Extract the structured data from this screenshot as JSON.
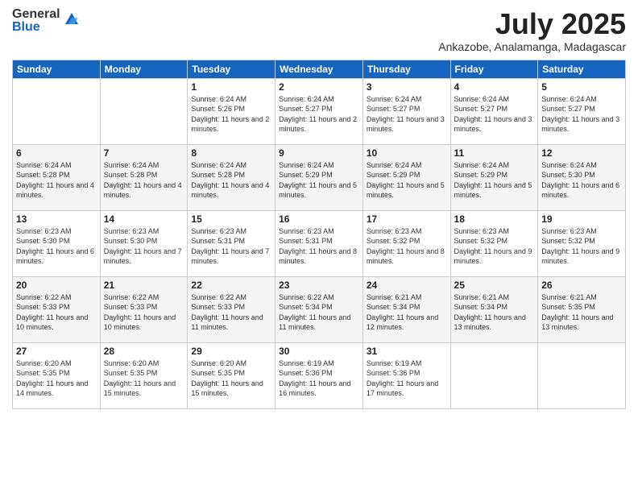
{
  "logo": {
    "general": "General",
    "blue": "Blue"
  },
  "title": "July 2025",
  "location": "Ankazobe, Analamanga, Madagascar",
  "headers": [
    "Sunday",
    "Monday",
    "Tuesday",
    "Wednesday",
    "Thursday",
    "Friday",
    "Saturday"
  ],
  "weeks": [
    [
      {
        "day": "",
        "sunrise": "",
        "sunset": "",
        "daylight": ""
      },
      {
        "day": "",
        "sunrise": "",
        "sunset": "",
        "daylight": ""
      },
      {
        "day": "1",
        "sunrise": "Sunrise: 6:24 AM",
        "sunset": "Sunset: 5:26 PM",
        "daylight": "Daylight: 11 hours and 2 minutes."
      },
      {
        "day": "2",
        "sunrise": "Sunrise: 6:24 AM",
        "sunset": "Sunset: 5:27 PM",
        "daylight": "Daylight: 11 hours and 2 minutes."
      },
      {
        "day": "3",
        "sunrise": "Sunrise: 6:24 AM",
        "sunset": "Sunset: 5:27 PM",
        "daylight": "Daylight: 11 hours and 3 minutes."
      },
      {
        "day": "4",
        "sunrise": "Sunrise: 6:24 AM",
        "sunset": "Sunset: 5:27 PM",
        "daylight": "Daylight: 11 hours and 3 minutes."
      },
      {
        "day": "5",
        "sunrise": "Sunrise: 6:24 AM",
        "sunset": "Sunset: 5:27 PM",
        "daylight": "Daylight: 11 hours and 3 minutes."
      }
    ],
    [
      {
        "day": "6",
        "sunrise": "Sunrise: 6:24 AM",
        "sunset": "Sunset: 5:28 PM",
        "daylight": "Daylight: 11 hours and 4 minutes."
      },
      {
        "day": "7",
        "sunrise": "Sunrise: 6:24 AM",
        "sunset": "Sunset: 5:28 PM",
        "daylight": "Daylight: 11 hours and 4 minutes."
      },
      {
        "day": "8",
        "sunrise": "Sunrise: 6:24 AM",
        "sunset": "Sunset: 5:28 PM",
        "daylight": "Daylight: 11 hours and 4 minutes."
      },
      {
        "day": "9",
        "sunrise": "Sunrise: 6:24 AM",
        "sunset": "Sunset: 5:29 PM",
        "daylight": "Daylight: 11 hours and 5 minutes."
      },
      {
        "day": "10",
        "sunrise": "Sunrise: 6:24 AM",
        "sunset": "Sunset: 5:29 PM",
        "daylight": "Daylight: 11 hours and 5 minutes."
      },
      {
        "day": "11",
        "sunrise": "Sunrise: 6:24 AM",
        "sunset": "Sunset: 5:29 PM",
        "daylight": "Daylight: 11 hours and 5 minutes."
      },
      {
        "day": "12",
        "sunrise": "Sunrise: 6:24 AM",
        "sunset": "Sunset: 5:30 PM",
        "daylight": "Daylight: 11 hours and 6 minutes."
      }
    ],
    [
      {
        "day": "13",
        "sunrise": "Sunrise: 6:23 AM",
        "sunset": "Sunset: 5:30 PM",
        "daylight": "Daylight: 11 hours and 6 minutes."
      },
      {
        "day": "14",
        "sunrise": "Sunrise: 6:23 AM",
        "sunset": "Sunset: 5:30 PM",
        "daylight": "Daylight: 11 hours and 7 minutes."
      },
      {
        "day": "15",
        "sunrise": "Sunrise: 6:23 AM",
        "sunset": "Sunset: 5:31 PM",
        "daylight": "Daylight: 11 hours and 7 minutes."
      },
      {
        "day": "16",
        "sunrise": "Sunrise: 6:23 AM",
        "sunset": "Sunset: 5:31 PM",
        "daylight": "Daylight: 11 hours and 8 minutes."
      },
      {
        "day": "17",
        "sunrise": "Sunrise: 6:23 AM",
        "sunset": "Sunset: 5:32 PM",
        "daylight": "Daylight: 11 hours and 8 minutes."
      },
      {
        "day": "18",
        "sunrise": "Sunrise: 6:23 AM",
        "sunset": "Sunset: 5:32 PM",
        "daylight": "Daylight: 11 hours and 9 minutes."
      },
      {
        "day": "19",
        "sunrise": "Sunrise: 6:23 AM",
        "sunset": "Sunset: 5:32 PM",
        "daylight": "Daylight: 11 hours and 9 minutes."
      }
    ],
    [
      {
        "day": "20",
        "sunrise": "Sunrise: 6:22 AM",
        "sunset": "Sunset: 5:33 PM",
        "daylight": "Daylight: 11 hours and 10 minutes."
      },
      {
        "day": "21",
        "sunrise": "Sunrise: 6:22 AM",
        "sunset": "Sunset: 5:33 PM",
        "daylight": "Daylight: 11 hours and 10 minutes."
      },
      {
        "day": "22",
        "sunrise": "Sunrise: 6:22 AM",
        "sunset": "Sunset: 5:33 PM",
        "daylight": "Daylight: 11 hours and 11 minutes."
      },
      {
        "day": "23",
        "sunrise": "Sunrise: 6:22 AM",
        "sunset": "Sunset: 5:34 PM",
        "daylight": "Daylight: 11 hours and 11 minutes."
      },
      {
        "day": "24",
        "sunrise": "Sunrise: 6:21 AM",
        "sunset": "Sunset: 5:34 PM",
        "daylight": "Daylight: 11 hours and 12 minutes."
      },
      {
        "day": "25",
        "sunrise": "Sunrise: 6:21 AM",
        "sunset": "Sunset: 5:34 PM",
        "daylight": "Daylight: 11 hours and 13 minutes."
      },
      {
        "day": "26",
        "sunrise": "Sunrise: 6:21 AM",
        "sunset": "Sunset: 5:35 PM",
        "daylight": "Daylight: 11 hours and 13 minutes."
      }
    ],
    [
      {
        "day": "27",
        "sunrise": "Sunrise: 6:20 AM",
        "sunset": "Sunset: 5:35 PM",
        "daylight": "Daylight: 11 hours and 14 minutes."
      },
      {
        "day": "28",
        "sunrise": "Sunrise: 6:20 AM",
        "sunset": "Sunset: 5:35 PM",
        "daylight": "Daylight: 11 hours and 15 minutes."
      },
      {
        "day": "29",
        "sunrise": "Sunrise: 6:20 AM",
        "sunset": "Sunset: 5:35 PM",
        "daylight": "Daylight: 11 hours and 15 minutes."
      },
      {
        "day": "30",
        "sunrise": "Sunrise: 6:19 AM",
        "sunset": "Sunset: 5:36 PM",
        "daylight": "Daylight: 11 hours and 16 minutes."
      },
      {
        "day": "31",
        "sunrise": "Sunrise: 6:19 AM",
        "sunset": "Sunset: 5:36 PM",
        "daylight": "Daylight: 11 hours and 17 minutes."
      },
      {
        "day": "",
        "sunrise": "",
        "sunset": "",
        "daylight": ""
      },
      {
        "day": "",
        "sunrise": "",
        "sunset": "",
        "daylight": ""
      }
    ]
  ]
}
